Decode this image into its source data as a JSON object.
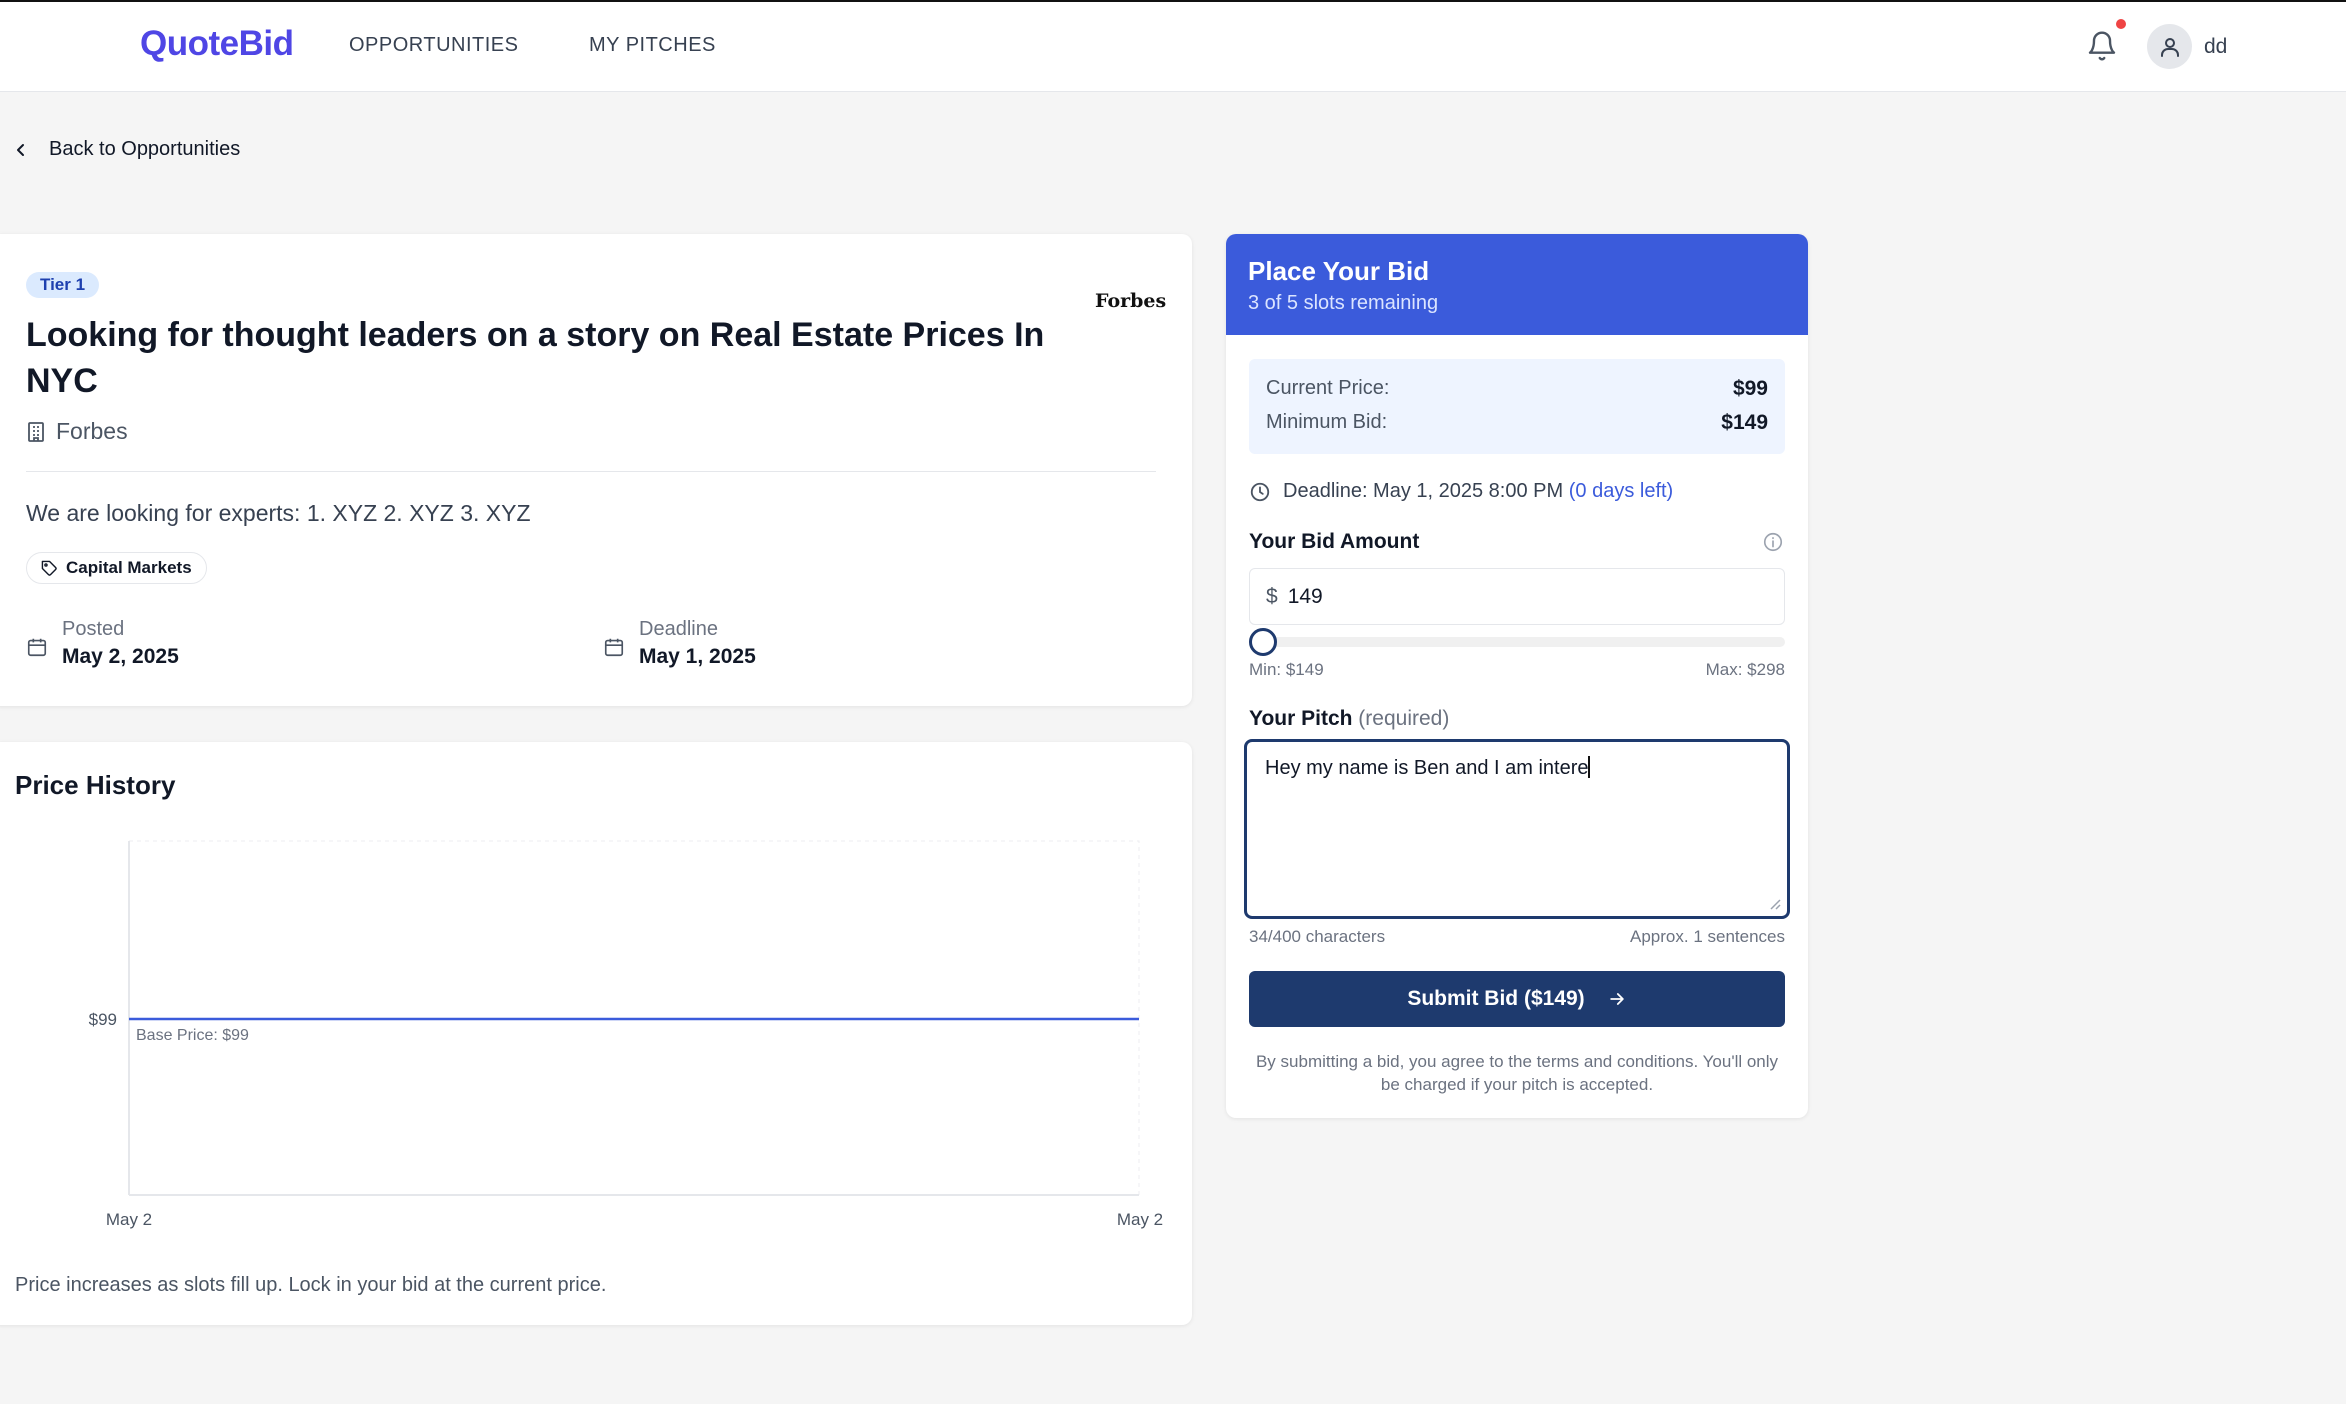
{
  "nav": {
    "logo": "QuoteBid",
    "links": [
      "OPPORTUNITIES",
      "MY PITCHES"
    ],
    "username": "dd"
  },
  "back_label": "Back to Opportunities",
  "opportunity": {
    "tier": "Tier 1",
    "outlet_logo": "Forbes",
    "title": "Looking for thought leaders on a story on Real Estate Prices In NYC",
    "outlet": "Forbes",
    "description": "We are looking for experts: 1. XYZ 2. XYZ 3. XYZ",
    "tag": "Capital Markets",
    "posted_label": "Posted",
    "posted_value": "May 2, 2025",
    "deadline_label": "Deadline",
    "deadline_value": "May 1, 2025"
  },
  "price_history": {
    "title": "Price History",
    "note": "Price increases as slots fill up. Lock in your bid at the current price.",
    "base_label": "Base Price: $99"
  },
  "chart_data": {
    "type": "line",
    "title": "Price History",
    "x": [
      "May 2",
      "May 2"
    ],
    "series": [
      {
        "values": [
          99,
          99
        ]
      }
    ],
    "y_ticks": [
      "$99"
    ],
    "x_ticks": [
      "May 2",
      "May 2"
    ],
    "annotations": [
      "Base Price: $99"
    ],
    "grid": true,
    "color": "#3b5bdb"
  },
  "bid": {
    "title": "Place Your Bid",
    "slots": "3 of 5 slots remaining",
    "current_price_label": "Current Price:",
    "current_price": "$99",
    "minimum_bid_label": "Minimum Bid:",
    "minimum_bid": "$149",
    "deadline_text": "Deadline: May 1, 2025 8:00 PM",
    "days_left": "(0 days left)",
    "amount_label": "Your Bid Amount",
    "currency": "$",
    "amount": "149",
    "slider_level": 0,
    "slider_min": "Min: $149",
    "slider_max": "Max: $298",
    "pitch_label": "Your Pitch",
    "pitch_required": "(required)",
    "pitch_text": "Hey my name is Ben and I am intere",
    "char_count": "34/400 characters",
    "sentence_count": "Approx. 1 sentences",
    "submit_label": "Submit Bid ($149)",
    "terms": "By submitting a bid, you agree to the terms and conditions. You'll only be charged if your pitch is accepted."
  },
  "colors": {
    "brand": "#4f46e5",
    "bid_header": "#3b5bdb",
    "submit": "#1e3a6e",
    "notification_dot": "#ef4444"
  }
}
